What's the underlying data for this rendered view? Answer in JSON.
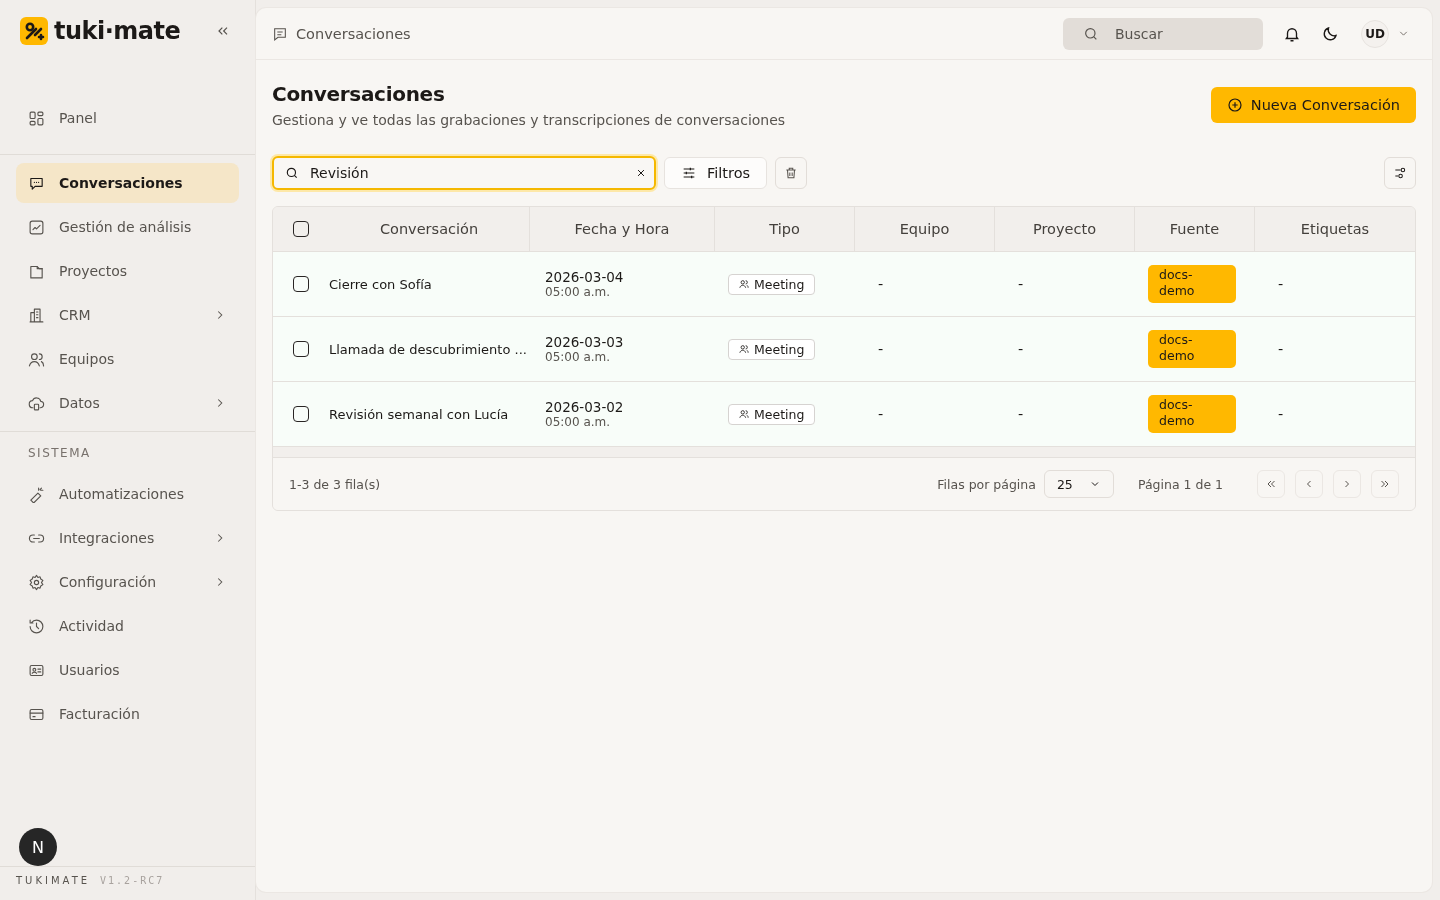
{
  "sidebar": {
    "logo": "tuki·mate",
    "top_items": [
      {
        "label": "Panel",
        "selected": false,
        "has_submenu": false
      }
    ],
    "main_items": [
      {
        "label": "Conversaciones",
        "selected": true,
        "has_submenu": false
      },
      {
        "label": "Gestión de análisis",
        "selected": false,
        "has_submenu": false
      },
      {
        "label": "Proyectos",
        "selected": false,
        "has_submenu": false
      },
      {
        "label": "CRM",
        "selected": false,
        "has_submenu": true
      },
      {
        "label": "Equipos",
        "selected": false,
        "has_submenu": false
      },
      {
        "label": "Datos",
        "selected": false,
        "has_submenu": true
      }
    ],
    "system_heading": "SISTEMA",
    "system_items": [
      {
        "label": "Automatizaciones",
        "selected": false,
        "has_submenu": false
      },
      {
        "label": "Integraciones",
        "selected": false,
        "has_submenu": true
      },
      {
        "label": "Configuración",
        "selected": false,
        "has_submenu": true
      },
      {
        "label": "Actividad",
        "selected": false,
        "has_submenu": false
      },
      {
        "label": "Usuarios",
        "selected": false,
        "has_submenu": false
      },
      {
        "label": "Facturación",
        "selected": false,
        "has_submenu": false
      }
    ],
    "floating_badge": "N",
    "footer_brand": "TUKIMATE",
    "footer_version": "V1.2-RC7"
  },
  "header": {
    "breadcrumb": "Conversaciones",
    "search": {
      "placeholder": "Buscar"
    },
    "avatar": "UD"
  },
  "page": {
    "title": "Conversaciones",
    "subtitle": "Gestiona y ve todas las grabaciones y transcripciones de conversaciones",
    "new_button": "Nueva Conversación"
  },
  "toolbar": {
    "search": {
      "value": "Revisión"
    },
    "filters_button": "Filtros"
  },
  "table": {
    "select_all": {
      "checked": false
    },
    "columns": [
      "Conversación",
      "Fecha y Hora",
      "Tipo",
      "Equipo",
      "Proyecto",
      "Fuente",
      "Etiquetas"
    ],
    "rows": [
      {
        "checked": false,
        "title": "Cierre con Sofía",
        "date": "2026-03-04",
        "time": "05:00 a.m.",
        "type": "Meeting",
        "team": "-",
        "project": "-",
        "source": "docs-demo",
        "tags": "-"
      },
      {
        "checked": false,
        "title": "Llamada de descubrimiento ...",
        "date": "2026-03-03",
        "time": "05:00 a.m.",
        "type": "Meeting",
        "team": "-",
        "project": "-",
        "source": "docs-demo",
        "tags": "-"
      },
      {
        "checked": false,
        "title": "Revisión semanal con Lucía",
        "date": "2026-03-02",
        "time": "05:00 a.m.",
        "type": "Meeting",
        "team": "-",
        "project": "-",
        "source": "docs-demo",
        "tags": "-"
      }
    ]
  },
  "pagination": {
    "summary": "1-3 de 3 fila(s)",
    "rows_per_page_label": "Filas por página",
    "rows_per_page": "25",
    "page_label": "Página 1 de 1"
  }
}
